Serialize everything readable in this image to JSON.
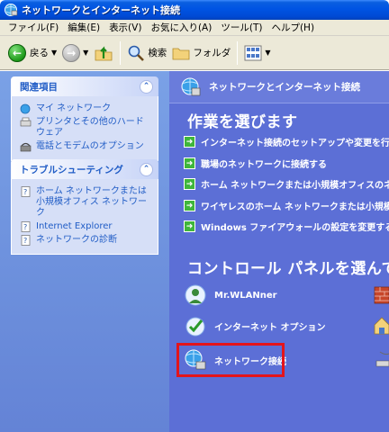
{
  "window": {
    "title": "ネットワークとインターネット接続"
  },
  "menu": [
    "ファイル(F)",
    "編集(E)",
    "表示(V)",
    "お気に入り(A)",
    "ツール(T)",
    "ヘルプ(H)"
  ],
  "toolbar": {
    "back": "戻る",
    "search": "検索",
    "folders": "フォルダ"
  },
  "sidebar": {
    "related": {
      "title": "関連項目",
      "items": [
        "マイ ネットワーク",
        "プリンタとその他のハードウェア",
        "電話とモデムのオプション"
      ]
    },
    "troubleshooting": {
      "title": "トラブルシューティング",
      "items": [
        "ホーム ネットワークまたは小規模オフィス ネットワーク",
        "Internet Explorer",
        "ネットワークの診断"
      ]
    }
  },
  "content": {
    "header": "ネットワークとインターネット接続",
    "tasks_title": "作業を選びます",
    "tasks": [
      "インターネット接続のセットアップや変更を行う",
      "職場のネットワークに接続する",
      "ホーム ネットワークまたは小規模オフィスのネットワ",
      "ワイヤレスのホーム ネットワークまたは小規模オフィス",
      "Windows ファイアウォールの設定を変更する"
    ],
    "cp_title": "コントロール パネルを選んで実",
    "cp_items": [
      "Mr.WLANner",
      "インターネット オプション",
      "ネットワーク接続"
    ]
  },
  "colors": {
    "highlight": "#e4141b",
    "task_bg": "#5c6fd6",
    "link": "#215dc6"
  }
}
